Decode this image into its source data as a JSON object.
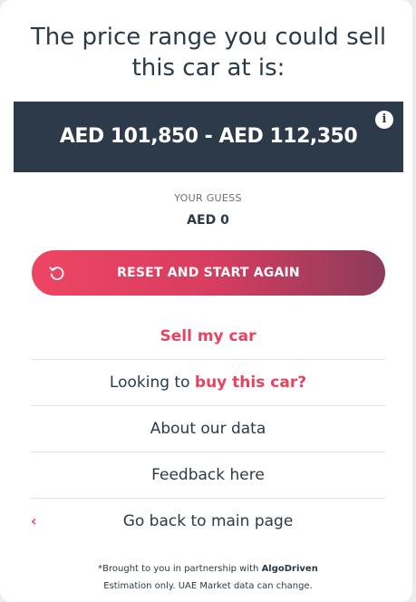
{
  "headline": {
    "line1": "The price range you could sell",
    "line2": "this car at is:"
  },
  "price_range": {
    "text": "AED 101,850 - AED 112,350",
    "info_icon": "info-icon"
  },
  "guess": {
    "label": "YOUR GUESS",
    "value": "AED 0"
  },
  "reset_button": {
    "label": "RESET AND START AGAIN",
    "icon": "refresh-icon"
  },
  "links": {
    "sell": "Sell my car",
    "buy_prefix": "Looking to ",
    "buy_accent": "buy this car?",
    "about": "About our data",
    "feedback": "Feedback here",
    "back": "Go back to main page",
    "back_icon": "chevron-left-icon"
  },
  "footer": {
    "line1_prefix": "*Brought to you in partnership with ",
    "line1_brand": "AlgoDriven",
    "line2": "Estimation only. UAE Market data can change."
  },
  "colors": {
    "accent": "#e8425f",
    "dark_panel": "#2c3a49",
    "text": "#2b3a47"
  }
}
